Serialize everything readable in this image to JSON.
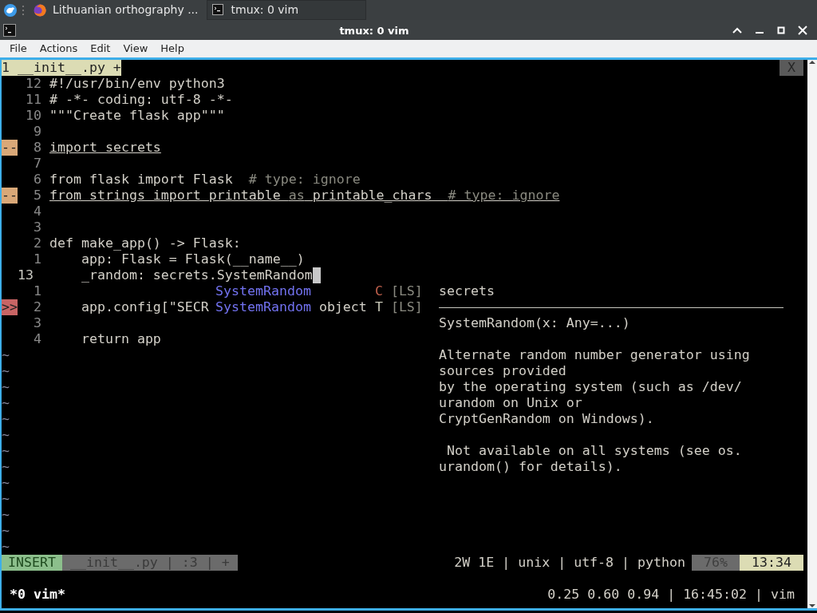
{
  "taskbar": {
    "tasks": [
      {
        "label": "Lithuanian orthography ...",
        "kind": "browser",
        "selected": false
      },
      {
        "label": "tmux: 0 vim",
        "kind": "terminal",
        "selected": true
      }
    ]
  },
  "window": {
    "title": "tmux: 0 vim"
  },
  "menu": [
    "File",
    "Actions",
    "Edit",
    "View",
    "Help"
  ],
  "vim": {
    "tabline": {
      "tabs": [
        {
          "label": "1 __init__.py +",
          "selected": true
        }
      ],
      "close": "X"
    },
    "lines": [
      {
        "number": "12",
        "current": false,
        "underlined": false,
        "segments": [
          {
            "text": "#!/usr/bin/env python3",
            "kind": "code"
          }
        ]
      },
      {
        "number": "11",
        "current": false,
        "underlined": false,
        "segments": [
          {
            "text": "# -*- coding: utf-8 -*-",
            "kind": "code"
          }
        ]
      },
      {
        "number": "10",
        "current": false,
        "underlined": false,
        "segments": [
          {
            "text": "\"\"\"Create flask app\"\"\"",
            "kind": "code"
          }
        ]
      },
      {
        "number": "9",
        "current": false
      },
      {
        "number": "8",
        "current": false,
        "underlined": true,
        "sign": {
          "text": "--",
          "kind": "warning"
        },
        "segments": [
          {
            "text": "import secrets",
            "kind": "code"
          }
        ]
      },
      {
        "number": "7",
        "current": false
      },
      {
        "number": "6",
        "current": false,
        "underlined": false,
        "segments": [
          {
            "text": "from flask import Flask  ",
            "kind": "code"
          },
          {
            "text": "# type: ignore",
            "kind": "comment"
          }
        ]
      },
      {
        "number": "5",
        "current": false,
        "underlined": true,
        "sign": {
          "text": "--",
          "kind": "warning"
        },
        "segments": [
          {
            "text": "from strings import printable ",
            "kind": "code"
          },
          {
            "text": "as",
            "kind": "comment"
          },
          {
            "text": " printable_chars  ",
            "kind": "code"
          },
          {
            "text": "# type: ignore",
            "kind": "comment"
          }
        ]
      },
      {
        "number": "4",
        "current": false
      },
      {
        "number": "3",
        "current": false
      },
      {
        "number": "2",
        "current": false,
        "underlined": false,
        "segments": [
          {
            "text": "def make_app() -> Flask:",
            "kind": "code"
          }
        ]
      },
      {
        "number": "1",
        "current": false,
        "underlined": false,
        "segments": [
          {
            "text": "    app: Flask = Flask(__name__)",
            "kind": "code"
          }
        ]
      },
      {
        "number": "13",
        "current": true,
        "underlined": false,
        "cursor": true,
        "segments": [
          {
            "text": "    _random: secrets.SystemRandom",
            "kind": "code"
          }
        ]
      },
      {
        "number": "1",
        "current": false
      },
      {
        "number": "2",
        "current": false,
        "underlined": false,
        "sign": {
          "text": ">>",
          "kind": "error"
        },
        "segments": [
          {
            "text": "    app.config[\"SECR",
            "kind": "code"
          }
        ]
      },
      {
        "number": "3",
        "current": false
      },
      {
        "number": "4",
        "current": false,
        "underlined": false,
        "segments": [
          {
            "text": "    return app",
            "kind": "code"
          }
        ]
      }
    ],
    "tildes": [
      "~",
      "~",
      "~",
      "~",
      "~",
      "~",
      "~",
      "~",
      "~",
      "~",
      "~",
      "~",
      "~"
    ],
    "completion": [
      {
        "word": "SystemRandom",
        "kind": "C",
        "color": "#c0604c",
        "source": "[LS]"
      },
      {
        "word": "SystemRandom",
        "menu": "object",
        "kind": "T",
        "color": "#c8c8b8",
        "source": "[LS]"
      }
    ],
    "doc": {
      "title": "secrets",
      "signature": "SystemRandom(x: Any=...)",
      "paragraphs": [
        [
          "Alternate random number generator using",
          "sources provided",
          "by the operating system (such as /dev/",
          "urandom on Unix or",
          "CryptGenRandom on Windows)."
        ],
        [
          " Not available on all systems (see os.",
          "urandom() for details)."
        ]
      ]
    },
    "status": {
      "mode": "INSERT",
      "file": "__init__.py | :3 | +",
      "info": "2W 1E | unix | utf-8 | python",
      "percent": "76%",
      "position": "13:34"
    }
  },
  "tmux": {
    "window": "*0 vim*",
    "status": "0.25 0.60 0.94 | 16:45:02 | vim"
  }
}
